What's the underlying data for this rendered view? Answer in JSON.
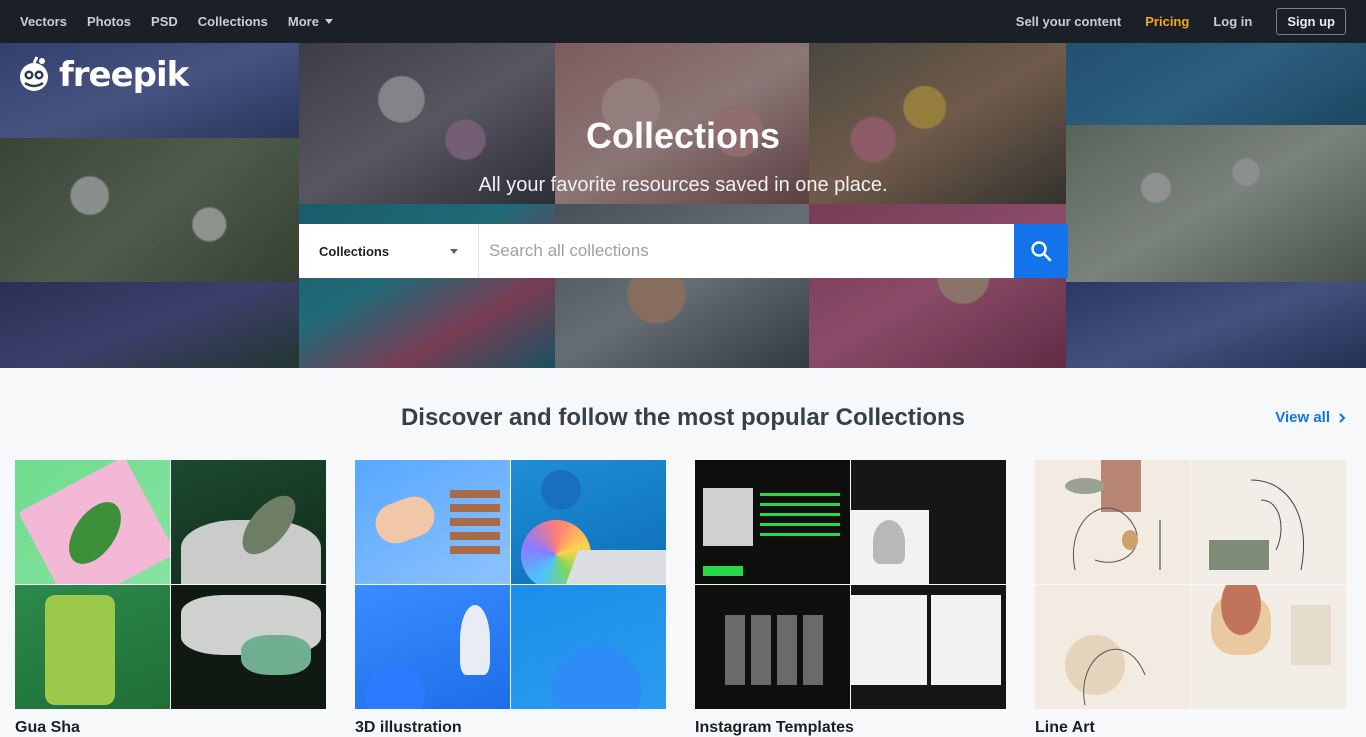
{
  "nav": {
    "left": [
      "Vectors",
      "Photos",
      "PSD",
      "Collections",
      "More"
    ],
    "sell": "Sell your content",
    "pricing": "Pricing",
    "login": "Log in",
    "signup": "Sign up",
    "pricing_color": "#f5a623"
  },
  "brand": {
    "name": "freepik"
  },
  "hero": {
    "title": "Collections",
    "subtitle": "All your favorite resources saved in one place."
  },
  "search": {
    "scope": "Collections",
    "placeholder": "Search all collections",
    "button_color": "#1273eb"
  },
  "discover": {
    "title": "Discover and follow the most popular Collections",
    "view_all": "View all"
  },
  "cards": [
    {
      "label": "Gua Sha"
    },
    {
      "label": "3D illustration"
    },
    {
      "label": "Instagram Templates"
    },
    {
      "label": "Line Art"
    }
  ]
}
